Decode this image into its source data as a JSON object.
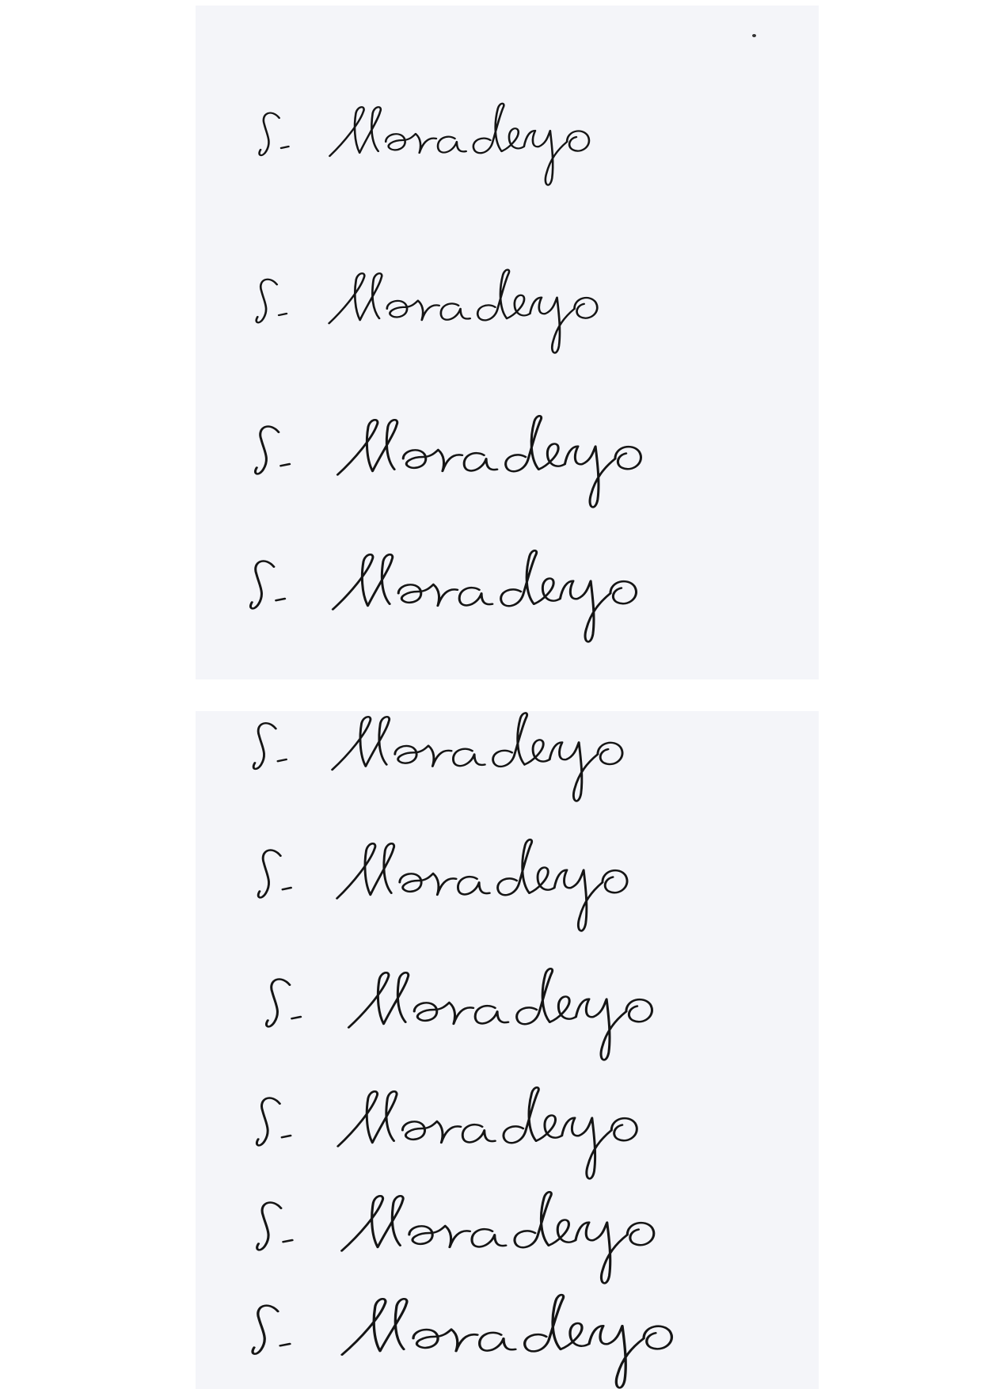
{
  "sheets": [
    {
      "name": "top-sheet",
      "signature_count": 4
    },
    {
      "name": "bottom-sheet",
      "signature_count": 6
    }
  ],
  "signature_text": "S. Moradeyo",
  "ink_color": "#151515",
  "paper_color": "#f4f5f9"
}
